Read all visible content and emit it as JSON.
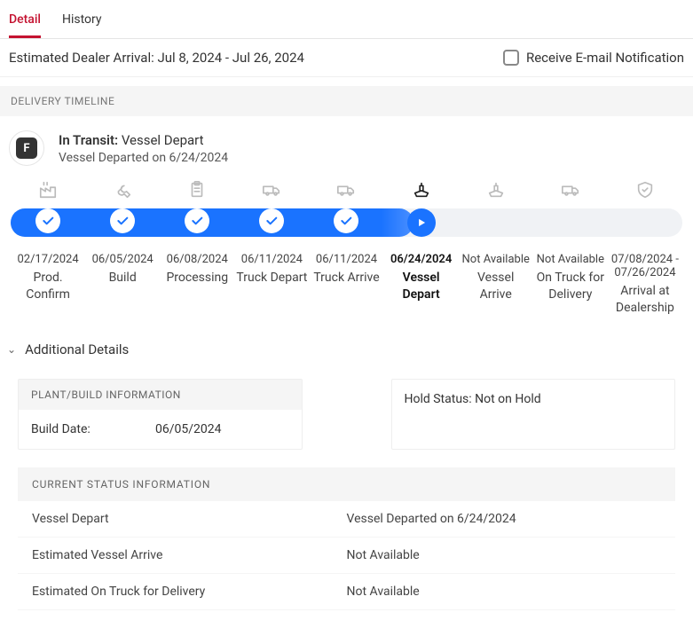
{
  "tabs": {
    "detail": "Detail",
    "history": "History"
  },
  "header": {
    "estimated_arrival": "Estimated Dealer Arrival: Jul 8, 2024 - Jul 26, 2024",
    "notification_label": "Receive E-mail Notification"
  },
  "sections": {
    "timeline_title": "DELIVERY TIMELINE",
    "additional_details": "Additional Details"
  },
  "status": {
    "icon_letter": "F",
    "prefix": "In Transit:",
    "stage": "Vessel Depart",
    "detail": "Vessel Departed on 6/24/2024"
  },
  "timeline": {
    "fill_percent": 60,
    "steps": [
      {
        "date": "02/17/2024",
        "name": "Prod. Confirm",
        "state": "done",
        "icon": "factory"
      },
      {
        "date": "06/05/2024",
        "name": "Build",
        "state": "done",
        "icon": "wrench"
      },
      {
        "date": "06/08/2024",
        "name": "Processing",
        "state": "done",
        "icon": "clipboard"
      },
      {
        "date": "06/11/2024",
        "name": "Truck Depart",
        "state": "done",
        "icon": "truck"
      },
      {
        "date": "06/11/2024",
        "name": "Truck Arrive",
        "state": "done",
        "icon": "truck"
      },
      {
        "date": "06/24/2024",
        "name": "Vessel Depart",
        "state": "current",
        "icon": "ship"
      },
      {
        "date": "Not Available",
        "name": "Vessel Arrive",
        "state": "pending",
        "icon": "ship"
      },
      {
        "date": "Not Available",
        "name": "On Truck for Delivery",
        "state": "pending",
        "icon": "truck"
      },
      {
        "date": "07/08/2024 - 07/26/2024",
        "name": "Arrival at Dealership",
        "state": "pending",
        "icon": "shield"
      }
    ]
  },
  "plant_info": {
    "title": "PLANT/BUILD INFORMATION",
    "build_date_label": "Build Date:",
    "build_date_value": "06/05/2024"
  },
  "hold_info": {
    "text": "Hold Status: Not on Hold"
  },
  "current_status": {
    "title": "CURRENT STATUS INFORMATION",
    "rows": [
      {
        "label": "Vessel Depart",
        "value": "Vessel Departed on  6/24/2024"
      },
      {
        "label": "Estimated Vessel Arrive",
        "value": "Not Available"
      },
      {
        "label": "Estimated On Truck for Delivery",
        "value": "Not Available"
      }
    ]
  }
}
